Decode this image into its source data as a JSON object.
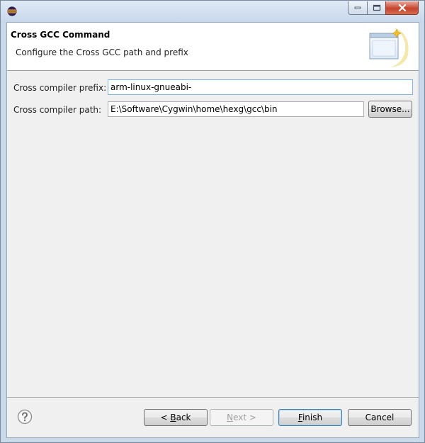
{
  "dialog": {
    "header": {
      "title": "Cross GCC Command",
      "description": "Configure the Cross GCC path and prefix"
    },
    "fields": {
      "prefix": {
        "label": "Cross compiler prefix:",
        "value": "arm-linux-gnueabi-"
      },
      "path": {
        "label": "Cross compiler path:",
        "value": "E:\\Software\\Cygwin\\home\\hexg\\gcc\\bin"
      }
    },
    "browse_label": "Browse...",
    "buttons": {
      "back_prefix": "< ",
      "back_mnemonic": "B",
      "back_rest": "ack",
      "next_mnemonic": "N",
      "next_rest": "ext >",
      "finish_mnemonic": "F",
      "finish_rest": "inish",
      "cancel": "Cancel"
    }
  },
  "icons": {
    "app": "eclipse-icon",
    "help": "help-icon",
    "wizard_banner": "wizard-window-icon"
  },
  "colors": {
    "close_button": "#c7432f",
    "focus_border": "#7eb4ea",
    "default_button_border": "#3c7fb1"
  }
}
